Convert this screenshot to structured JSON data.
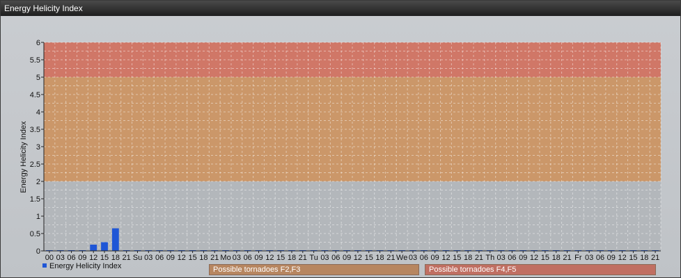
{
  "window": {
    "title": "Energy Helicity Index"
  },
  "colors": {
    "bar": "#1f56d6",
    "band_low": "#d8863e",
    "band_high": "#e0543a",
    "band_low_legend": "#b78660",
    "band_high_legend": "#c06f62"
  },
  "chart_data": {
    "type": "bar",
    "ylabel": "Energy Helicity Index",
    "ylim": [
      0,
      6
    ],
    "y_ticks": [
      "0",
      "0.5",
      "1",
      "1.5",
      "2",
      "2.5",
      "3",
      "3.5",
      "4",
      "4.5",
      "5",
      "5.5",
      "6"
    ],
    "grid": true,
    "legend_position": "bottom-left",
    "categories": [
      "00",
      "03",
      "06",
      "09",
      "12",
      "15",
      "18",
      "21",
      "Su",
      "03",
      "06",
      "09",
      "12",
      "15",
      "18",
      "21",
      "Mo",
      "03",
      "06",
      "09",
      "12",
      "15",
      "18",
      "21",
      "Tu",
      "03",
      "06",
      "09",
      "12",
      "15",
      "18",
      "21",
      "We",
      "03",
      "06",
      "09",
      "12",
      "15",
      "18",
      "21",
      "Th",
      "03",
      "06",
      "09",
      "12",
      "15",
      "18",
      "21",
      "Fr",
      "03",
      "06",
      "09",
      "12",
      "15",
      "18",
      "21"
    ],
    "series": [
      {
        "name": "Energy Helicity Index",
        "values": [
          0,
          0,
          0,
          0,
          0.18,
          0.25,
          0.65,
          0.02,
          0.01,
          0.01,
          0.01,
          0.01,
          0.01,
          0.01,
          0.01,
          0.01,
          0.01,
          0.01,
          0.01,
          0.01,
          0.01,
          0.01,
          0.01,
          0.01,
          0.01,
          0.01,
          0.01,
          0.01,
          0.01,
          0.01,
          0.01,
          0.01,
          0.01,
          0.01,
          0.01,
          0.01,
          0.01,
          0.01,
          0.01,
          0.01,
          0.01,
          0.01,
          0.01,
          0.01,
          0.01,
          0.01,
          0.01,
          0.01,
          0.01,
          0.01,
          0.01,
          0.01,
          0.01,
          0.01,
          0.01,
          0.01
        ]
      }
    ],
    "bands": [
      {
        "label": "Possible tornadoes F2,F3",
        "from": 2,
        "to": 5
      },
      {
        "label": "Possible tornadoes F4,F5",
        "from": 5,
        "to": 6
      }
    ]
  }
}
